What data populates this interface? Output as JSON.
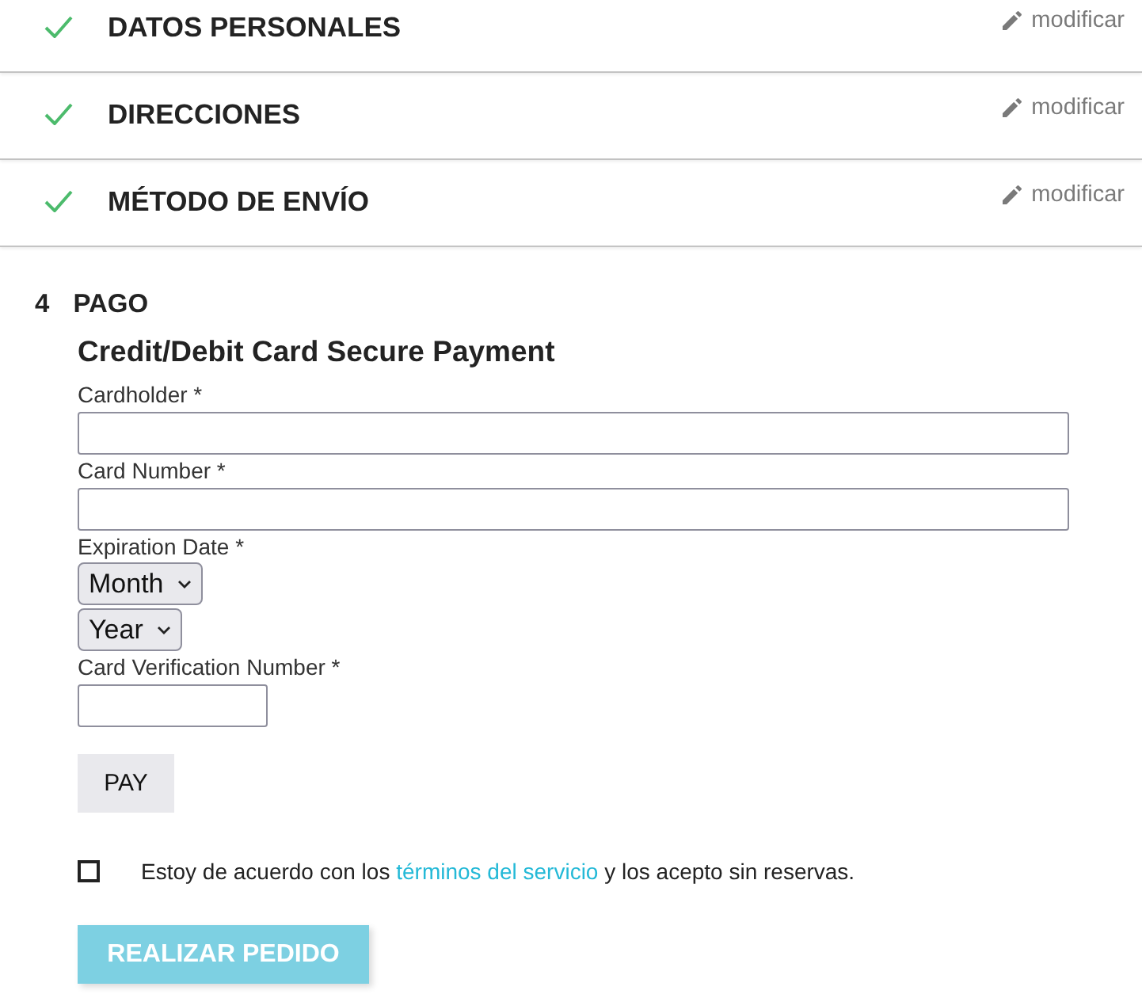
{
  "steps": [
    {
      "title": "DATOS PERSONALES",
      "done": true,
      "edit_label": "modificar"
    },
    {
      "title": "DIRECCIONES",
      "done": true,
      "edit_label": "modificar"
    },
    {
      "title": "MÉTODO DE ENVÍO",
      "done": true,
      "edit_label": "modificar"
    }
  ],
  "current_step": {
    "number": "4",
    "title": "PAGO"
  },
  "payment": {
    "heading": "Credit/Debit Card Secure Payment",
    "fields": [
      {
        "kind": "text",
        "label": "Cardholder *"
      },
      {
        "kind": "text",
        "label": "Card Number *"
      },
      {
        "kind": "selects",
        "label": "Expiration Date *",
        "selects": [
          "Month",
          "Year"
        ]
      },
      {
        "kind": "short_text",
        "label": "Card Verification Number *"
      }
    ],
    "pay_button": "PAY"
  },
  "terms": {
    "checked": false,
    "text_before": "Estoy de acuerdo con los",
    "link": "términos del servicio",
    "text_after": "y los acepto sin reservas."
  },
  "order_button": {
    "label": "REALIZAR PEDIDO",
    "disabled": true
  }
}
